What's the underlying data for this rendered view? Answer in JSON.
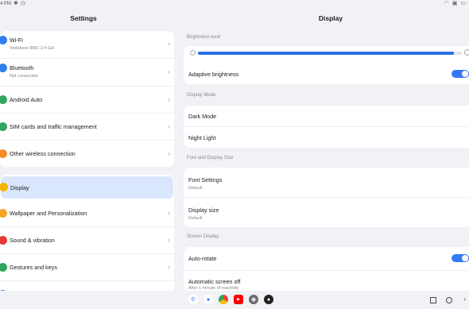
{
  "status": {
    "time": "4 PM"
  },
  "left": {
    "title": "Settings",
    "group1": [
      {
        "label": "Wi-Fi",
        "sub": "Vodafone-9881 2.4 GH",
        "icon": "wifi-icon",
        "color": "#2f80ed"
      },
      {
        "label": "Bluetooth",
        "sub": "Not connected",
        "icon": "bluetooth-icon",
        "color": "#2f80ed"
      },
      {
        "label": "Android Auto",
        "sub": "",
        "icon": "android-auto-icon",
        "color": "#2fa65a"
      },
      {
        "label": "SIM cards and traffic management",
        "sub": "",
        "icon": "sim-icon",
        "color": "#2fa65a"
      },
      {
        "label": "Other wireless connection",
        "sub": "",
        "icon": "wireless-icon",
        "color": "#f28c28"
      }
    ],
    "group2": [
      {
        "label": "Display",
        "icon": "display-icon",
        "color": "#f5b400"
      },
      {
        "label": "Wallpaper and Personalization",
        "icon": "wallpaper-icon",
        "color": "#f5a623"
      },
      {
        "label": "Sound & vibration",
        "icon": "sound-icon",
        "color": "#e53935"
      },
      {
        "label": "Gestures and keys",
        "icon": "gestures-icon",
        "color": "#2fa65a"
      }
    ]
  },
  "right": {
    "title": "Display",
    "brightness_header": "Brightness level",
    "brightness_level": 0.97,
    "adaptive_brightness": "Adaptive brightness",
    "display_mode_header": "Display Mode",
    "dark_mode": "Dark Mode",
    "night_light": "Night Light",
    "font_header": "Font and Display Size",
    "font_settings": "Font Settings",
    "font_settings_sub": "Default",
    "display_size": "Display size",
    "display_size_sub": "Default",
    "screen_header": "Screen Display",
    "auto_rotate": "Auto-rotate",
    "screen_off": "Automatic screen off",
    "screen_off_sub": "After 1 minute of inactivity"
  },
  "colors": {
    "accent": "#3478f6",
    "selected_bg": "#d9e6fb"
  }
}
